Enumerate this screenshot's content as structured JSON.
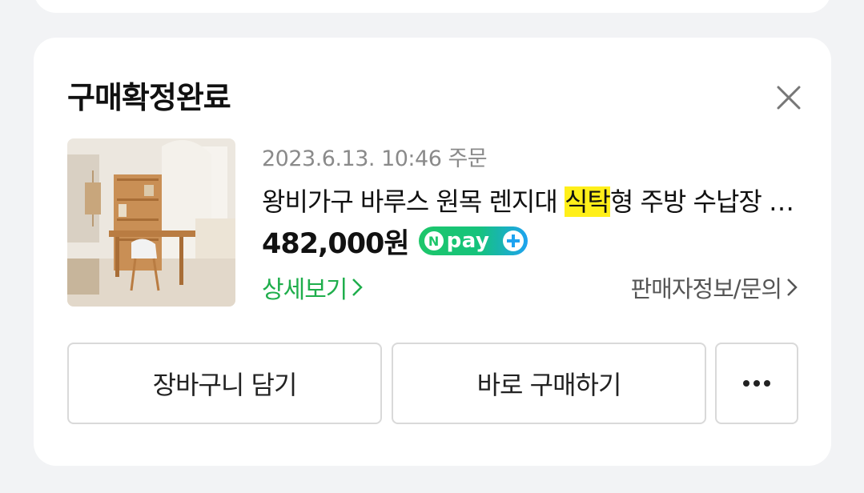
{
  "card": {
    "title": "구매확정완료"
  },
  "product": {
    "order_date": "2023.6.13. 10:46 주문",
    "name_before": "왕비가구 바루스 원목 렌지대 ",
    "name_highlight": "식탁",
    "name_after": "형 주방 수납장 …",
    "price": "482,000원",
    "npay_label": "pay",
    "npay_letter": "N",
    "image": "wooden-desk-shelf-photo"
  },
  "links": {
    "detail": "상세보기",
    "seller": "판매자정보/문의"
  },
  "buttons": {
    "cart": "장바구니 담기",
    "buy": "바로 구매하기",
    "more_icon": "more-dots-icon"
  },
  "colors": {
    "accent_green": "#1fae4c",
    "highlight": "#ffef1a",
    "background": "#f2f3f5"
  }
}
